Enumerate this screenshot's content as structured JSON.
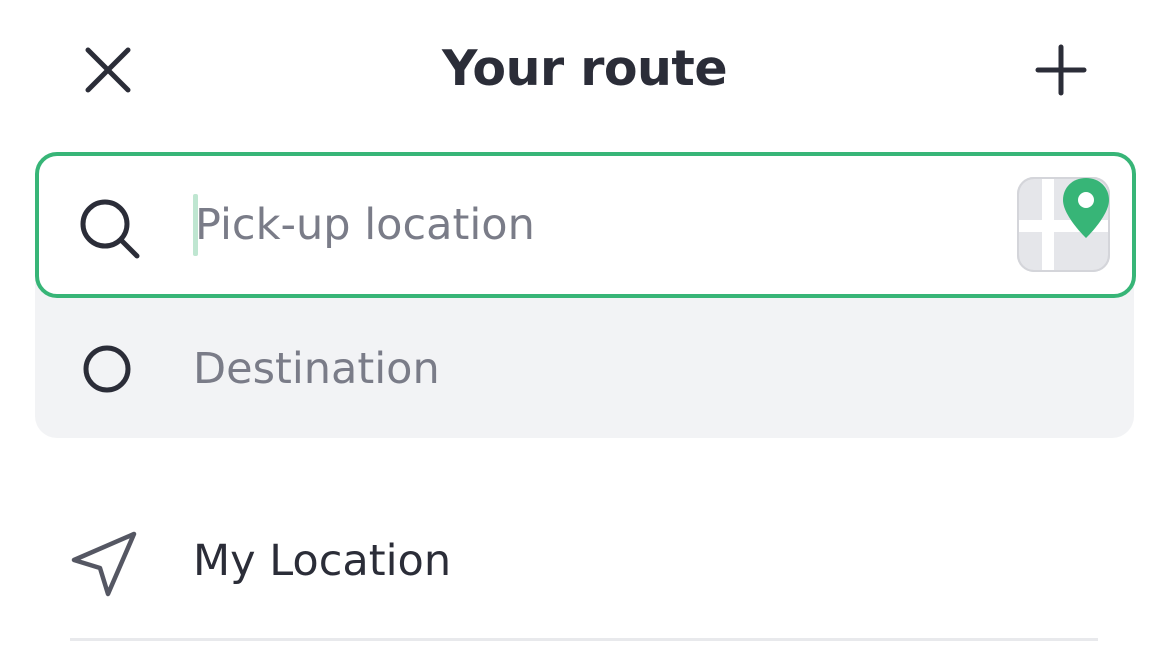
{
  "header": {
    "title": "Your route",
    "close_icon": "close-icon",
    "add_icon": "plus-icon"
  },
  "route": {
    "pickup": {
      "placeholder": "Pick-up location",
      "value": "",
      "icon": "search-icon",
      "map_button_icon": "map-pin-icon"
    },
    "destination": {
      "label": "Destination",
      "icon": "circle-icon"
    }
  },
  "suggestions": {
    "my_location": {
      "label": "My Location",
      "icon": "navigation-arrow-icon"
    }
  },
  "colors": {
    "accent": "#37b577",
    "text_primary": "#2b2d38",
    "text_placeholder": "#7a7c88",
    "panel_bg": "#f2f3f5"
  }
}
